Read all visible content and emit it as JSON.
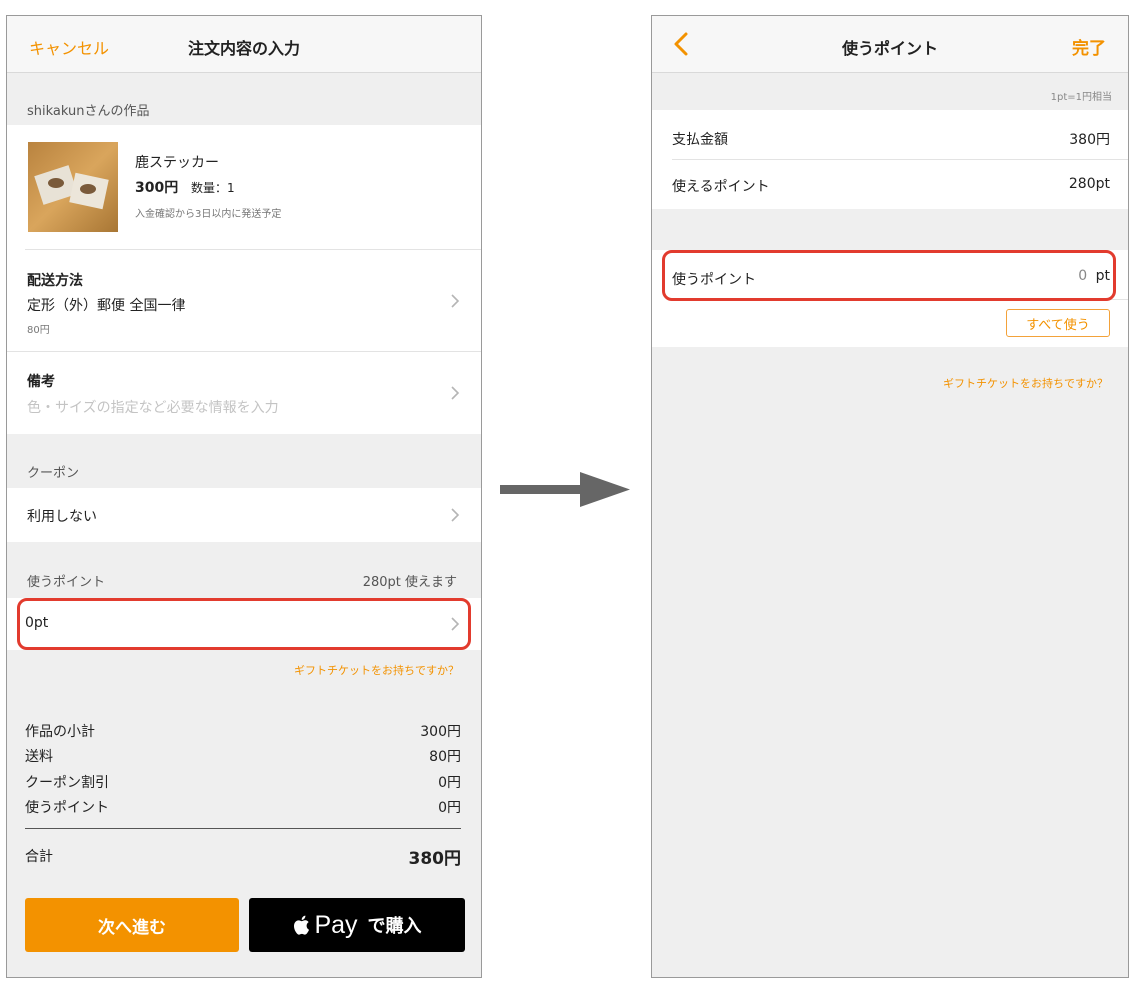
{
  "left_screen": {
    "nav": {
      "cancel": "キャンセル",
      "title": "注文内容の入力"
    },
    "shop_header": "shikakunさんの作品",
    "product": {
      "name": "鹿ステッカー",
      "price": "300円",
      "quantity_label": "数量：1",
      "shipping_note": "入金確認から3日以内に発送予定"
    },
    "delivery": {
      "title": "配送方法",
      "method": "定形（外）郵便 全国一律",
      "fee": "80円"
    },
    "remarks": {
      "title": "備考",
      "placeholder": "色・サイズの指定など必要な情報を入力"
    },
    "coupon": {
      "header": "クーポン",
      "value": "利用しない"
    },
    "points": {
      "header": "使うポイント",
      "available": "280pt 使えます",
      "value": "0pt"
    },
    "gift_link": "ギフトチケットをお持ちですか？",
    "summary": [
      {
        "label": "作品の小計",
        "value": "300円"
      },
      {
        "label": "送料",
        "value": "80円"
      },
      {
        "label": "クーポン割引",
        "value": "0円"
      },
      {
        "label": "使うポイント",
        "value": "0円"
      }
    ],
    "total": {
      "label": "合計",
      "value": "380円"
    },
    "buttons": {
      "next": "次へ進む",
      "apple_pay_word": "Pay",
      "apple_pay_suffix": "で購入"
    }
  },
  "arrow": "right-arrow",
  "right_screen": {
    "nav": {
      "back_icon": "chevron-left-icon",
      "title": "使うポイント",
      "done": "完了"
    },
    "rate_note": "1pt=1円相当",
    "payment": {
      "label": "支払金額",
      "value": "380円"
    },
    "usable": {
      "label": "使えるポイント",
      "value": "280pt"
    },
    "use_points": {
      "label": "使うポイント",
      "value": "0",
      "unit": "pt"
    },
    "use_all_button": "すべて使う",
    "gift_link": "ギフトチケットをお持ちですか？"
  },
  "colors": {
    "accent": "#f39200",
    "highlight": "#e23b2e",
    "background": "#efefef",
    "arrow": "#666666"
  }
}
